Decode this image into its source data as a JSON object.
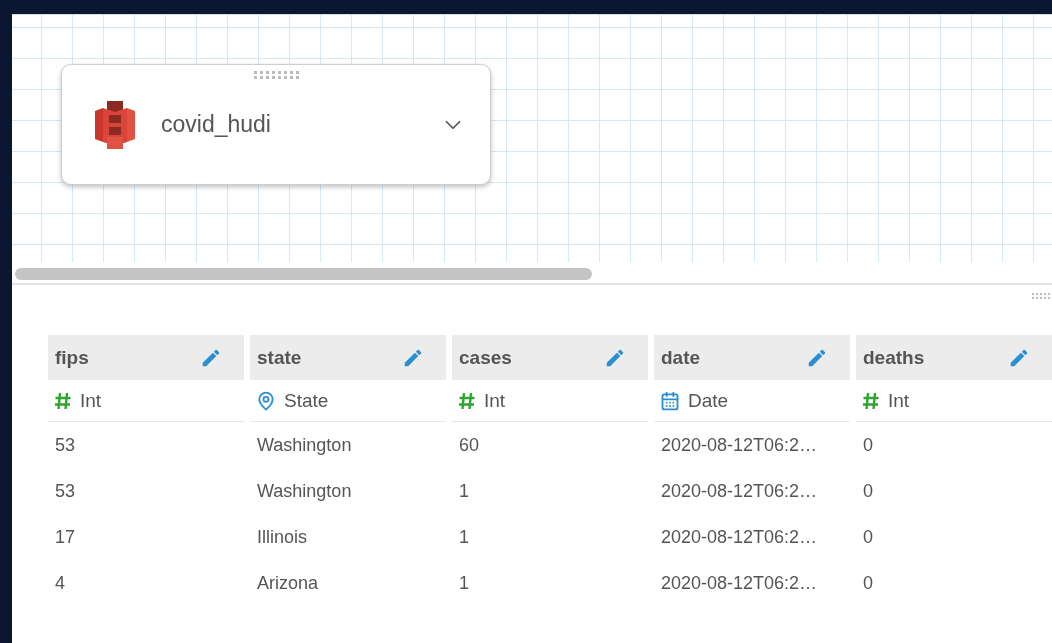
{
  "dataset_card": {
    "name": "covid_hudi"
  },
  "table": {
    "columns": [
      {
        "name": "fips",
        "type_label": "Int",
        "kind": "number"
      },
      {
        "name": "state",
        "type_label": "State",
        "kind": "geo"
      },
      {
        "name": "cases",
        "type_label": "Int",
        "kind": "number"
      },
      {
        "name": "date",
        "type_label": "Date",
        "kind": "date"
      },
      {
        "name": "deaths",
        "type_label": "Int",
        "kind": "number"
      }
    ],
    "rows": [
      [
        "53",
        "Washington",
        "60",
        "2020-08-12T06:2…",
        "0"
      ],
      [
        "53",
        "Washington",
        "1",
        "2020-08-12T06:2…",
        "0"
      ],
      [
        "17",
        "Illinois",
        "1",
        "2020-08-12T06:2…",
        "0"
      ],
      [
        "4",
        "Arizona",
        "1",
        "2020-08-12T06:2…",
        "0"
      ]
    ]
  }
}
